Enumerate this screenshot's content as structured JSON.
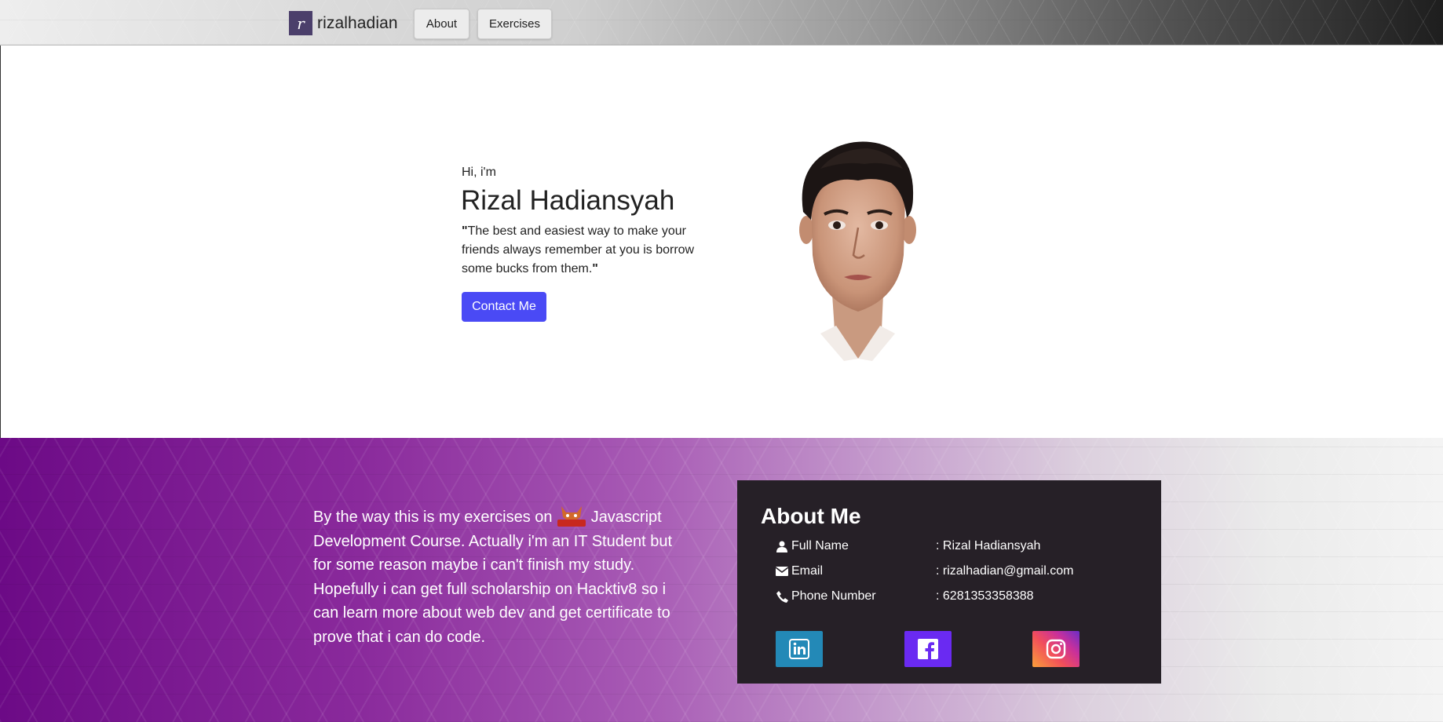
{
  "navbar": {
    "brand_initial": "r",
    "brand_text": "rizalhadian",
    "about_label": "About",
    "exercises_label": "Exercises"
  },
  "hero": {
    "greeting": "Hi, i'm",
    "name": "Rizal Hadiansyah",
    "quote_open": "\"",
    "quote_text": "The best and easiest way to make your friends always remember at you is borrow some bucks from them.",
    "quote_close": "\"",
    "contact_label": "Contact Me"
  },
  "about_text": {
    "before_icon": "By the way this is my exercises on",
    "icon_text": "HACKTIV8",
    "after_icon": "Javascript Development Course. Actually i'm an IT Student but for some reason maybe i can't finish my study. Hopefully i can get full scholarship on Hacktiv8 so i can learn more about web dev and get certificate to prove that i can do code."
  },
  "about_card": {
    "title": "About Me",
    "rows": [
      {
        "icon": "user-icon",
        "label": "Full Name",
        "value": ": Rizal Hadiansyah"
      },
      {
        "icon": "envelope-icon",
        "label": "Email",
        "value": ": rizalhadian@gmail.com"
      },
      {
        "icon": "phone-icon",
        "label": "Phone Number",
        "value": ": 6281353358388"
      }
    ],
    "social": [
      {
        "icon": "linkedin-icon",
        "color": "#2389b7"
      },
      {
        "icon": "facebook-icon",
        "color": "#6a2af2"
      },
      {
        "icon": "instagram-icon",
        "color": "#c9309b"
      }
    ]
  },
  "colors": {
    "accent_button": "#4a4af5",
    "card_bg": "#262027",
    "purple": "#6c0a86"
  }
}
